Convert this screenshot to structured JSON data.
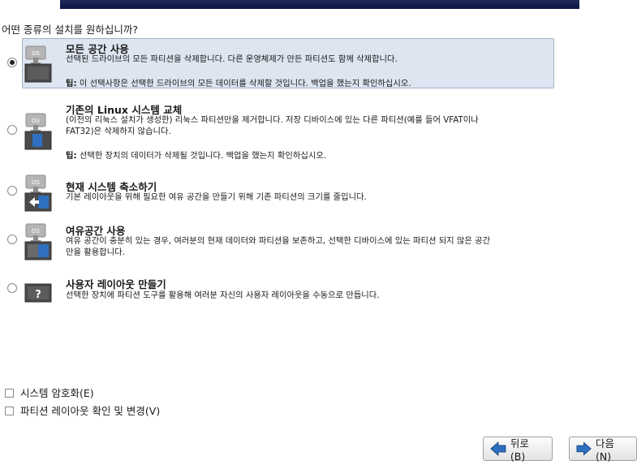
{
  "question": "어떤 종류의 설치를 원하십니까?",
  "options": [
    {
      "title": "모든 공간 사용",
      "description": [
        "선택된 드라이브의 모든 파티션을 삭제합니다. 다른 운영체제가 만든 파티션도 함께 삭제합니다."
      ],
      "tip_label": "팁:",
      "tip_text": " 이 선택사항은 선택한 드라이브의 모든 데이터를 삭제할 것입니다. 백업을 했는지 확인하십시오.",
      "selected": true,
      "icon": "os-drive-empty-icon"
    },
    {
      "title_prefix": "기존의 ",
      "title_bold_part": "Linux",
      "title_suffix": " 시스템 교체",
      "description": [
        "(이전의 리눅스 설치가 생성한) 리눅스 파티션만을 제거합니다. 저장 디바이스에 있는 다른 파티션(예를 들어 VFAT이나",
        "FAT32)은 삭제하지 않습니다."
      ],
      "tip_label": "팁:",
      "tip_text": " 선택한 장치의 데이터가 삭제될 것입니다. 백업을 했는지 확인하십시오.",
      "selected": false,
      "icon": "os-drive-replace-icon"
    },
    {
      "title": "현재 시스템 축소하기",
      "description": [
        "기본 레이아웃을 위해 필요한 여유 공간을 만들기 위해 기존 파티션의 크기를 줄입니다."
      ],
      "selected": false,
      "icon": "os-drive-shrink-icon"
    },
    {
      "title": "여유공간 사용",
      "description": [
        "여유 공간이 충분히 있는 경우, 여러분의 현재 데이터와 파티션을 보존하고, 선택한 디바이스에 있는 파티션 되지 않은 공간",
        "만을 활용합니다."
      ],
      "selected": false,
      "icon": "os-drive-freespace-icon"
    },
    {
      "title": "사용자 레이아웃 만들기",
      "description": [
        "선택한 장치에 파티션 도구를 활용해 여러분 자신의 사용자 레이아웃을 수동으로 만듭니다."
      ],
      "selected": false,
      "icon": "question-drive-icon"
    }
  ],
  "checkboxes": [
    {
      "label": "시스템 암호화(E)",
      "checked": false
    },
    {
      "label": "파티션 레이아웃 확인 및 변경(V)",
      "checked": false
    }
  ],
  "buttons": {
    "back_label": "뒤로(B)",
    "next_label": "다음(N)"
  },
  "colors": {
    "highlight_bg": "#dde5f0",
    "highlight_border": "#9fb1c8",
    "banner": "#0d1640",
    "icon_drive": "#4a4a4a",
    "icon_blue": "#2f6fbf"
  }
}
